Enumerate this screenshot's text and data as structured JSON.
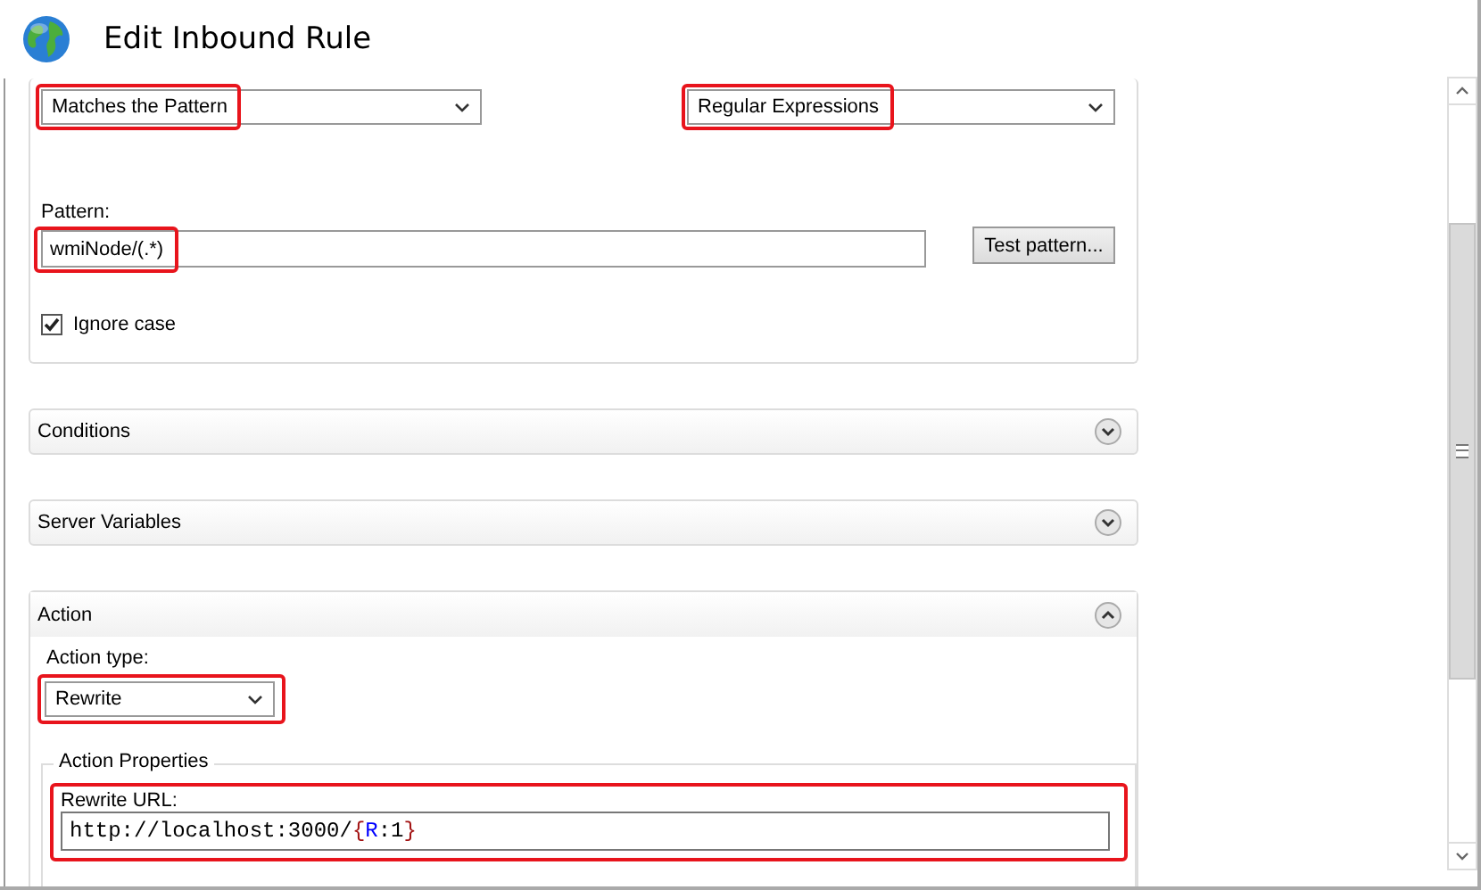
{
  "window": {
    "title": "Edit Inbound Rule"
  },
  "match": {
    "url_dropdown": {
      "value": "Matches the Pattern",
      "highlighted": true
    },
    "using_dropdown": {
      "value": "Regular Expressions",
      "highlighted": true
    },
    "pattern_label": "Pattern:",
    "pattern_field": {
      "value": "wmiNode/(.*)",
      "highlighted": true
    },
    "test_button": "Test pattern...",
    "ignore_case": {
      "label": "Ignore case",
      "checked": true
    }
  },
  "collapsible_sections": [
    {
      "title": "Conditions",
      "expanded": false
    },
    {
      "title": "Server Variables",
      "expanded": false
    }
  ],
  "action": {
    "title": "Action",
    "expanded": true,
    "action_type_label": "Action type:",
    "action_type": {
      "value": "Rewrite",
      "highlighted": true
    },
    "properties_legend": "Action Properties",
    "rewrite_url_label": "Rewrite URL:",
    "rewrite_url": {
      "highlighted": true,
      "tokens": [
        {
          "text": "http://localhost:3000/",
          "kind": "plain"
        },
        {
          "text": "{",
          "kind": "brace"
        },
        {
          "text": "R",
          "kind": "server"
        },
        {
          "text": ":1",
          "kind": "plain"
        },
        {
          "text": "}",
          "kind": "brace"
        }
      ]
    }
  }
}
